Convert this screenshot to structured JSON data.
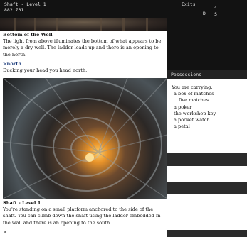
{
  "status": {
    "location": "Shaft - Level 1",
    "score": "882,701",
    "exits_label": "Exits",
    "exit_directions": [
      "D",
      "S"
    ],
    "exit_arrow": "⌃"
  },
  "story": {
    "bottom_well": {
      "heading": "Bottom of the Well",
      "text": "The light from above illuminates the bottom of what appears to be merely a dry well. The ladder leads up and there is an opening to the north."
    },
    "command": ">north",
    "response": "Ducking your head you head north.",
    "shaft": {
      "heading": "Shaft - Level 1",
      "text": "You're standing on a small platform anchored to the side of the shaft. You can climb down the shaft using the ladder embedded in the wall and there is an opening to the south."
    },
    "prompt": ">"
  },
  "sidebar": {
    "possessions_label": "Possessions",
    "carrying_label": "You are carrying:",
    "items": [
      {
        "label": "a box of matches",
        "level": 0
      },
      {
        "label": "five matches",
        "level": 1
      },
      {
        "label": "a poker",
        "level": 0
      },
      {
        "label": "the workshop key",
        "level": 0
      },
      {
        "label": "a pocket watch",
        "level": 0
      },
      {
        "label": "a petal",
        "level": 0
      }
    ]
  },
  "colors": {
    "bar_bg": "#121212",
    "link_blue": "#1a3a7a",
    "glow": "#e9942a"
  }
}
